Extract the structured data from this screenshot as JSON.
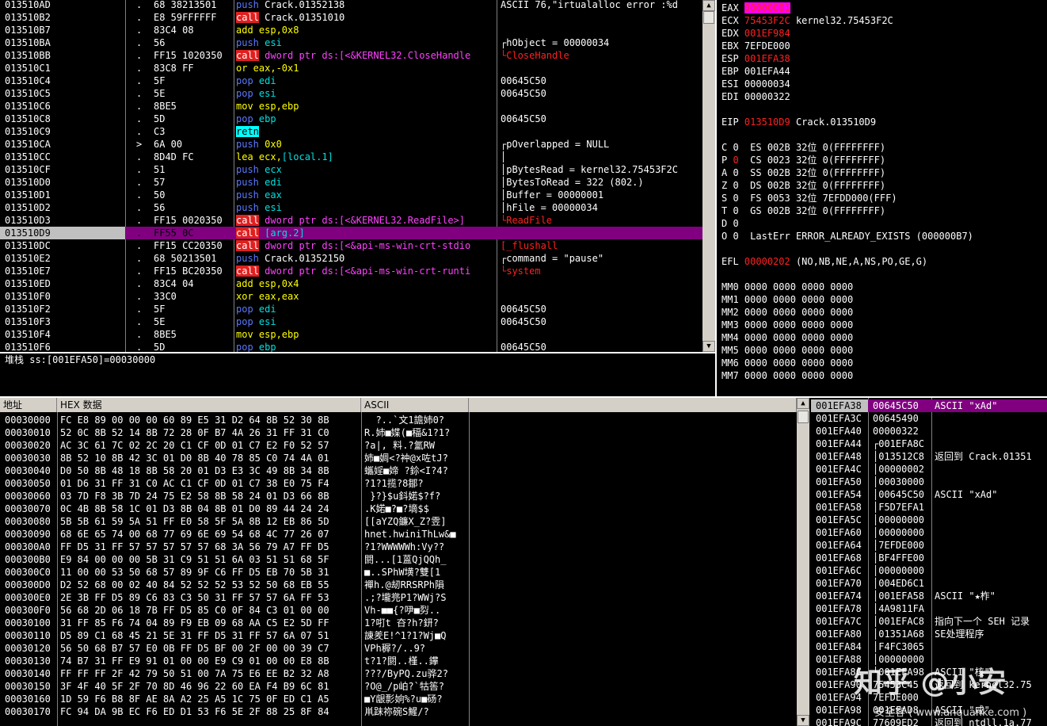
{
  "disasm": {
    "rows": [
      {
        "addr": "013510AD",
        "mark": ".",
        "hex": "68 38213501",
        "ins": [
          {
            "t": "push",
            "c": "blue"
          },
          {
            "t": " Crack.01352138"
          }
        ],
        "cmt": "ASCII 76,\"irtualalloc error :%d"
      },
      {
        "addr": "013510B2",
        "mark": ".",
        "hex": "E8 59FFFFFF",
        "ins": [
          {
            "t": "call",
            "c": "callbg"
          },
          {
            "t": " Crack.01351010"
          }
        ],
        "cmt": ""
      },
      {
        "addr": "013510B7",
        "mark": ".",
        "hex": "83C4 08",
        "ins": [
          {
            "t": "add esp,",
            "c": "yellow"
          },
          {
            "t": "0x8",
            "c": "yellow"
          }
        ],
        "cmt": ""
      },
      {
        "addr": "013510BA",
        "mark": ".",
        "hex": "56",
        "ins": [
          {
            "t": "push",
            "c": "blue"
          },
          {
            "t": " esi",
            "c": "cyan"
          }
        ],
        "cmt": "┌hObject = 00000034"
      },
      {
        "addr": "013510BB",
        "mark": ".",
        "hex": "FF15 1020350",
        "ins": [
          {
            "t": "call",
            "c": "callbg"
          },
          {
            "t": " dword ptr ds:[<&KERNEL32.CloseHandle",
            "c": "mag"
          }
        ],
        "cmt": "└CloseHandle",
        "cc": "red"
      },
      {
        "addr": "013510C1",
        "mark": ".",
        "hex": "83C8 FF",
        "ins": [
          {
            "t": "or eax,",
            "c": "yellow"
          },
          {
            "t": "-0x1",
            "c": "yellow"
          }
        ],
        "cmt": ""
      },
      {
        "addr": "013510C4",
        "mark": ".",
        "hex": "5F",
        "ins": [
          {
            "t": "pop",
            "c": "blue"
          },
          {
            "t": " edi",
            "c": "cyan"
          }
        ],
        "cmt": "00645C50"
      },
      {
        "addr": "013510C5",
        "mark": ".",
        "hex": "5E",
        "ins": [
          {
            "t": "pop",
            "c": "blue"
          },
          {
            "t": " esi",
            "c": "cyan"
          }
        ],
        "cmt": "00645C50"
      },
      {
        "addr": "013510C6",
        "mark": ".",
        "hex": "8BE5",
        "ins": [
          {
            "t": "mov esp,ebp",
            "c": "yellow"
          }
        ],
        "cmt": ""
      },
      {
        "addr": "013510C8",
        "mark": ".",
        "hex": "5D",
        "ins": [
          {
            "t": "pop",
            "c": "blue"
          },
          {
            "t": " ebp",
            "c": "cyan"
          }
        ],
        "cmt": "00645C50"
      },
      {
        "addr": "013510C9",
        "mark": ".",
        "hex": "C3",
        "ins": [
          {
            "t": "retn",
            "c": "retbg"
          }
        ],
        "cmt": ""
      },
      {
        "addr": "013510CA",
        "mark": ">",
        "hex": "6A 00",
        "ins": [
          {
            "t": "push",
            "c": "blue"
          },
          {
            "t": " 0x0",
            "c": "yellow"
          }
        ],
        "cmt": "┌pOverlapped = NULL"
      },
      {
        "addr": "013510CC",
        "mark": ".",
        "hex": "8D4D FC",
        "ins": [
          {
            "t": "lea ecx,",
            "c": "yellow"
          },
          {
            "t": "[local.1]",
            "c": "cyan"
          }
        ],
        "cmt": "│"
      },
      {
        "addr": "013510CF",
        "mark": ".",
        "hex": "51",
        "ins": [
          {
            "t": "push",
            "c": "blue"
          },
          {
            "t": " ecx",
            "c": "cyan"
          }
        ],
        "cmt": "│pBytesRead = kernel32.75453F2C"
      },
      {
        "addr": "013510D0",
        "mark": ".",
        "hex": "57",
        "ins": [
          {
            "t": "push",
            "c": "blue"
          },
          {
            "t": " edi",
            "c": "cyan"
          }
        ],
        "cmt": "│BytesToRead = 322 (802.)"
      },
      {
        "addr": "013510D1",
        "mark": ".",
        "hex": "50",
        "ins": [
          {
            "t": "push",
            "c": "blue"
          },
          {
            "t": " eax",
            "c": "cyan"
          }
        ],
        "cmt": "│Buffer = 00000001"
      },
      {
        "addr": "013510D2",
        "mark": ".",
        "hex": "56",
        "ins": [
          {
            "t": "push",
            "c": "blue"
          },
          {
            "t": " esi",
            "c": "cyan"
          }
        ],
        "cmt": "│hFile = 00000034"
      },
      {
        "addr": "013510D3",
        "mark": ".",
        "hex": "FF15 0020350",
        "ins": [
          {
            "t": "call",
            "c": "callbg"
          },
          {
            "t": " dword ptr ds:[<&KERNEL32.ReadFile>]",
            "c": "mag"
          }
        ],
        "cmt": "└ReadFile",
        "cc": "red"
      },
      {
        "addr": "013510D9",
        "mark": ".",
        "hex": "FF55 0C",
        "ins": [
          {
            "t": "call",
            "c": "callbg"
          },
          {
            "t": " [arg.2]",
            "c": "cyan"
          }
        ],
        "cmt": "",
        "sel": true
      },
      {
        "addr": "013510DC",
        "mark": ".",
        "hex": "FF15 CC20350",
        "ins": [
          {
            "t": "call",
            "c": "callbg"
          },
          {
            "t": " dword ptr ds:[<&api-ms-win-crt-stdio",
            "c": "mag"
          }
        ],
        "cmt": "[_flushall",
        "cc": "red"
      },
      {
        "addr": "013510E2",
        "mark": ".",
        "hex": "68 50213501",
        "ins": [
          {
            "t": "push",
            "c": "blue"
          },
          {
            "t": " Crack.01352150"
          }
        ],
        "cmt": "┌command = \"pause\""
      },
      {
        "addr": "013510E7",
        "mark": ".",
        "hex": "FF15 BC20350",
        "ins": [
          {
            "t": "call",
            "c": "callbg"
          },
          {
            "t": " dword ptr ds:[<&api-ms-win-crt-runti",
            "c": "mag"
          }
        ],
        "cmt": "└system",
        "cc": "red"
      },
      {
        "addr": "013510ED",
        "mark": ".",
        "hex": "83C4 04",
        "ins": [
          {
            "t": "add esp,",
            "c": "yellow"
          },
          {
            "t": "0x4",
            "c": "yellow"
          }
        ],
        "cmt": ""
      },
      {
        "addr": "013510F0",
        "mark": ".",
        "hex": "33C0",
        "ins": [
          {
            "t": "xor eax,eax",
            "c": "yellow"
          }
        ],
        "cmt": ""
      },
      {
        "addr": "013510F2",
        "mark": ".",
        "hex": "5F",
        "ins": [
          {
            "t": "pop",
            "c": "blue"
          },
          {
            "t": " edi",
            "c": "cyan"
          }
        ],
        "cmt": "00645C50"
      },
      {
        "addr": "013510F3",
        "mark": ".",
        "hex": "5E",
        "ins": [
          {
            "t": "pop",
            "c": "blue"
          },
          {
            "t": " esi",
            "c": "cyan"
          }
        ],
        "cmt": "00645C50"
      },
      {
        "addr": "013510F4",
        "mark": ".",
        "hex": "8BE5",
        "ins": [
          {
            "t": "mov esp,ebp",
            "c": "yellow"
          }
        ],
        "cmt": ""
      },
      {
        "addr": "013510F6",
        "mark": ".",
        "hex": "5D",
        "ins": [
          {
            "t": "pop",
            "c": "blue"
          },
          {
            "t": " ebp",
            "c": "cyan"
          }
        ],
        "cmt": "00645C50"
      }
    ]
  },
  "info_line": "堆栈 ss:[001EFA50]=00030000",
  "registers": {
    "rows": [
      {
        "name": "EAX",
        "val": "00000001",
        "note": "",
        "vc": "red",
        "vbg": "mag"
      },
      {
        "name": "ECX",
        "val": "75453F2C",
        "note": "kernel32.75453F2C",
        "vc": "red"
      },
      {
        "name": "EDX",
        "val": "001EF984",
        "note": "",
        "vc": "red"
      },
      {
        "name": "EBX",
        "val": "7EFDE000",
        "note": ""
      },
      {
        "name": "ESP",
        "val": "001EFA38",
        "note": "",
        "vc": "red"
      },
      {
        "name": "EBP",
        "val": "001EFA44",
        "note": ""
      },
      {
        "name": "ESI",
        "val": "00000034",
        "note": ""
      },
      {
        "name": "EDI",
        "val": "00000322",
        "note": ""
      },
      {
        "name": "",
        "val": "",
        "note": ""
      },
      {
        "name": "EIP",
        "val": "013510D9",
        "note": "Crack.013510D9",
        "vc": "red"
      },
      {
        "name": "",
        "val": "",
        "note": ""
      },
      {
        "name": "C 0",
        "val": " ES 002B 32位 0(FFFFFFFF)",
        "note": ""
      },
      {
        "name": "P",
        "val": "0",
        "note": " CS 0023 32位 0(FFFFFFFF)",
        "vc": "red"
      },
      {
        "name": "A 0",
        "val": " SS 002B 32位 0(FFFFFFFF)",
        "note": ""
      },
      {
        "name": "Z 0",
        "val": " DS 002B 32位 0(FFFFFFFF)",
        "note": ""
      },
      {
        "name": "S 0",
        "val": " FS 0053 32位 7EFDD000(FFF)",
        "note": ""
      },
      {
        "name": "T 0",
        "val": " GS 002B 32位 0(FFFFFFFF)",
        "note": ""
      },
      {
        "name": "D 0",
        "val": "",
        "note": ""
      },
      {
        "name": "O 0",
        "val": " LastErr ERROR_ALREADY_EXISTS (000000B7)",
        "note": ""
      },
      {
        "name": "",
        "val": "",
        "note": ""
      },
      {
        "name": "EFL",
        "val": "00000202",
        "note": "(NO,NB,NE,A,NS,PO,GE,G)",
        "vc": "red"
      },
      {
        "name": "",
        "val": "",
        "note": ""
      },
      {
        "name": "MM0",
        "val": "0000 0000 0000 0000",
        "note": ""
      },
      {
        "name": "MM1",
        "val": "0000 0000 0000 0000",
        "note": ""
      },
      {
        "name": "MM2",
        "val": "0000 0000 0000 0000",
        "note": ""
      },
      {
        "name": "MM3",
        "val": "0000 0000 0000 0000",
        "note": ""
      },
      {
        "name": "MM4",
        "val": "0000 0000 0000 0000",
        "note": ""
      },
      {
        "name": "MM5",
        "val": "0000 0000 0000 0000",
        "note": ""
      },
      {
        "name": "MM6",
        "val": "0000 0000 0000 0000",
        "note": ""
      },
      {
        "name": "MM7",
        "val": "0000 0000 0000 0000",
        "note": ""
      }
    ]
  },
  "dump": {
    "headers": {
      "addr": "地址",
      "hex": "HEX 数据",
      "ascii": "ASCII"
    },
    "rows": [
      {
        "addr": "00030000",
        "hex": "FC E8 89 00 00 00 60 89 E5 31 D2 64 8B 52 30 8B",
        "ascii": "  ?..`文1譫姉0?"
      },
      {
        "addr": "00030010",
        "hex": "52 0C 8B 52 14 8B 72 28 0F B7 4A 26 31 FF 31 C0",
        "ascii": "R.姉■媟(■稫&1?1?"
      },
      {
        "addr": "00030020",
        "hex": "AC 3C 61 7C 02 2C 20 C1 CF 0D 01 C7 E2 F0 52 57",
        "ascii": "?a|, 料.?氳RW"
      },
      {
        "addr": "00030030",
        "hex": "8B 52 10 8B 42 3C 01 D0 8B 40 78 85 C0 74 4A 01",
        "ascii": "姉■婤<?衶@x咗tJ?"
      },
      {
        "addr": "00030040",
        "hex": "D0 50 8B 48 18 8B 58 20 01 D3 E3 3C 49 8B 34 8B",
        "ascii": "蠵婬■媂 ?鉩<I?4?"
      },
      {
        "addr": "00030050",
        "hex": "01 D6 31 FF 31 C0 AC C1 CF 0D 01 C7 38 E0 75 F4",
        "ascii": "?1?1揽?8鄒?"
      },
      {
        "addr": "00030060",
        "hex": "03 7D F8 3B 7D 24 75 E2 58 8B 58 24 01 D3 66 8B",
        "ascii": " }?}$u鈄婼$?f?"
      },
      {
        "addr": "00030070",
        "hex": "0C 4B 8B 58 1C 01 D3 8B 04 8B 01 D0 89 44 24 24",
        "ascii": ".K婼■?■?墑$$"
      },
      {
        "addr": "00030080",
        "hex": "5B 5B 61 59 5A 51 FF E0 58 5F 5A 8B 12 EB 86 5D",
        "ascii": "[[aYZQ鐮X_Z?雴]"
      },
      {
        "addr": "00030090",
        "hex": "68 6E 65 74 00 68 77 69 6E 69 54 68 4C 77 26 07",
        "ascii": "hnet.hwiniThLw&■"
      },
      {
        "addr": "000300A0",
        "hex": "FF D5 31 FF 57 57 57 57 57 68 3A 56 79 A7 FF D5",
        "ascii": "?1?WWWWWh:Vy??"
      },
      {
        "addr": "000300B0",
        "hex": "E9 84 00 00 00 5B 31 C9 51 51 6A 03 51 51 68 5F",
        "ascii": "閼...[1蒕QjQQh_"
      },
      {
        "addr": "000300C0",
        "hex": "11 00 00 53 50 68 57 89 9F C6 FF D5 EB 70 5B 31",
        "ascii": "■..SPhW墴?雙[1"
      },
      {
        "addr": "000300D0",
        "hex": "D2 52 68 00 02 40 84 52 52 52 53 52 50 68 EB 55",
        "ascii": "襌h.@刼RRSRPh隕"
      },
      {
        "addr": "000300E0",
        "hex": "2E 3B FF D5 89 C6 83 C3 50 31 FF 57 57 6A FF 53",
        "ascii": ".;?壠兠P1?WWj?S"
      },
      {
        "addr": "000300F0",
        "hex": "56 68 2D 06 18 7B FF D5 85 C0 0F 84 C3 01 00 00",
        "ascii": "Vh-■■{?吚■劽.."
      },
      {
        "addr": "00030100",
        "hex": "31 FF 85 F6 74 04 89 F9 EB 09 68 AA C5 E2 5D FF",
        "ascii": "1?咑t 夻?h?鈃?"
      },
      {
        "addr": "00030110",
        "hex": "D5 89 C1 68 45 21 5E 31 FF D5 31 FF 57 6A 07 51",
        "ascii": "諌羑E!^1?1?Wj■Q"
      },
      {
        "addr": "00030120",
        "hex": "56 50 68 B7 57 E0 0B FF D5 BF 00 2F 00 00 39 C7",
        "ascii": "VPh稺?/..9?"
      },
      {
        "addr": "00030130",
        "hex": "74 B7 31 FF E9 91 01 00 00 E9 C9 01 00 00 E8 8B",
        "ascii": "t?1?閼..槿..鑻"
      },
      {
        "addr": "00030140",
        "hex": "FF FF FF 2F 42 79 50 51 00 7A 75 E6 EE B2 32 A8",
        "ascii": "???/ByPQ.zu骅2?"
      },
      {
        "addr": "00030150",
        "hex": "3F 4F 40 5F 2F 70 8D 46 96 22 60 EA F4 B9 6C 81",
        "ascii": "?O@_/p岶?`牯筶?"
      },
      {
        "addr": "00030160",
        "hex": "1D 59 F6 B8 8F AE 8A A2 25 A5 1C 75 0F ED C1 A5",
        "ascii": "■Y龈彯姠%?u■砀?"
      },
      {
        "addr": "00030170",
        "hex": "FC 94 DA 9B EC F6 ED D1 53 F6 5E 2F 88 25 8F 84",
        "ascii": "鼡跊祢碗S鯹/?"
      }
    ]
  },
  "stack": {
    "rows": [
      {
        "addr": "001EFA38",
        "val": "00645C50",
        "cmt": "ASCII \"xAd\"",
        "sel": true
      },
      {
        "addr": "001EFA3C",
        "val": "00645490",
        "cmt": ""
      },
      {
        "addr": "001EFA40",
        "val": "00000322",
        "cmt": ""
      },
      {
        "addr": "001EFA44",
        "val": "┌001EFA8C",
        "cmt": ""
      },
      {
        "addr": "001EFA48",
        "val": "│013512C8",
        "cmt": "返回到 Crack.01351"
      },
      {
        "addr": "001EFA4C",
        "val": "│00000002",
        "cmt": ""
      },
      {
        "addr": "001EFA50",
        "val": "│00030000",
        "cmt": ""
      },
      {
        "addr": "001EFA54",
        "val": "│00645C50",
        "cmt": "ASCII \"xAd\""
      },
      {
        "addr": "001EFA58",
        "val": "│F5D7EFA1",
        "cmt": ""
      },
      {
        "addr": "001EFA5C",
        "val": "│00000000",
        "cmt": ""
      },
      {
        "addr": "001EFA60",
        "val": "│00000000",
        "cmt": ""
      },
      {
        "addr": "001EFA64",
        "val": "│7EFDE000",
        "cmt": ""
      },
      {
        "addr": "001EFA68",
        "val": "│BF4FFE00",
        "cmt": ""
      },
      {
        "addr": "001EFA6C",
        "val": "│00000000",
        "cmt": ""
      },
      {
        "addr": "001EFA70",
        "val": "│004ED6C1",
        "cmt": ""
      },
      {
        "addr": "001EFA74",
        "val": "│001EFA58",
        "cmt": "ASCII \"★柞\""
      },
      {
        "addr": "001EFA78",
        "val": "│4A9811FA",
        "cmt": ""
      },
      {
        "addr": "001EFA7C",
        "val": "│001EFAC8",
        "cmt": "指向下一个 SEH 记录"
      },
      {
        "addr": "001EFA80",
        "val": "│01351A68",
        "cmt": "SE处理程序"
      },
      {
        "addr": "001EFA84",
        "val": "│F4FC3065",
        "cmt": ""
      },
      {
        "addr": "001EFA88",
        "val": "│00000000",
        "cmt": ""
      },
      {
        "addr": "001EFA8C",
        "val": "└001EFA98",
        "cmt": "ASCII \"核\""
      },
      {
        "addr": "001EFA90",
        "val": "75453C45",
        "cmt": "返回到 kernel32.75"
      },
      {
        "addr": "001EFA94",
        "val": "7EFDE000",
        "cmt": ""
      },
      {
        "addr": "001EFA98",
        "val": "001EFAD8",
        "cmt": "ASCII \"咸\""
      },
      {
        "addr": "001EFA9C",
        "val": "77609ED2",
        "cmt": "返回到 ntdll.1a.77"
      }
    ]
  },
  "watermark": {
    "brand": "知乎 @小安",
    "sub": "安全客 ( www.anquanke.com )"
  }
}
